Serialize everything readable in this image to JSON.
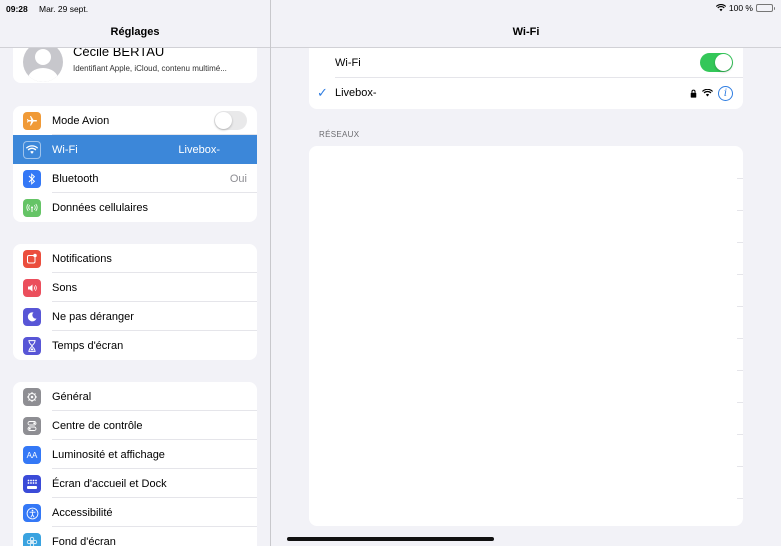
{
  "status_bar": {
    "time": "09:28",
    "date": "Mar. 29 sept.",
    "battery": "100 %",
    "battery_color": "#34c759"
  },
  "sidebar": {
    "title": "Réglages",
    "profile": {
      "name": "Cécile BERTAU",
      "subtitle": "Identifiant Apple, iCloud, contenu multimé..."
    },
    "group1": [
      {
        "label": "Mode Avion",
        "icon": "airplane-icon",
        "color": "#f09a37",
        "toggle": false
      },
      {
        "label": "Wi-Fi",
        "icon": "wifi-icon",
        "color": "#3478f6",
        "value": "Livebox-",
        "selected": true
      },
      {
        "label": "Bluetooth",
        "icon": "bluetooth-icon",
        "color": "#3478f6",
        "value": "Oui"
      },
      {
        "label": "Données cellulaires",
        "icon": "antenna-icon",
        "color": "#65c466"
      }
    ],
    "group2": [
      {
        "label": "Notifications",
        "icon": "notifications-icon",
        "color": "#eb4e3d"
      },
      {
        "label": "Sons",
        "icon": "speaker-icon",
        "color": "#eb4e5c"
      },
      {
        "label": "Ne pas déranger",
        "icon": "moon-icon",
        "color": "#5856d6"
      },
      {
        "label": "Temps d'écran",
        "icon": "hourglass-icon",
        "color": "#5856d6"
      }
    ],
    "group3": [
      {
        "label": "Général",
        "icon": "gear-icon",
        "color": "#8e8e93"
      },
      {
        "label": "Centre de contrôle",
        "icon": "switches-icon",
        "color": "#8e8e93"
      },
      {
        "label": "Luminosité et affichage",
        "icon": "text-size-icon",
        "color": "#3478f6"
      },
      {
        "label": "Écran d'accueil et Dock",
        "icon": "home-grid-icon",
        "color": "#3b4bd8"
      },
      {
        "label": "Accessibilité",
        "icon": "accessibility-icon",
        "color": "#3478f6"
      },
      {
        "label": "Fond d'écran",
        "icon": "flower-icon",
        "color": "#3aa3e0"
      }
    ]
  },
  "main": {
    "title": "Wi-Fi",
    "wifi_label": "Wi-Fi",
    "wifi_on": true,
    "connected_network": "Livebox-",
    "networks_section": "RÉSEAUX",
    "accent": "#2f7de1"
  }
}
